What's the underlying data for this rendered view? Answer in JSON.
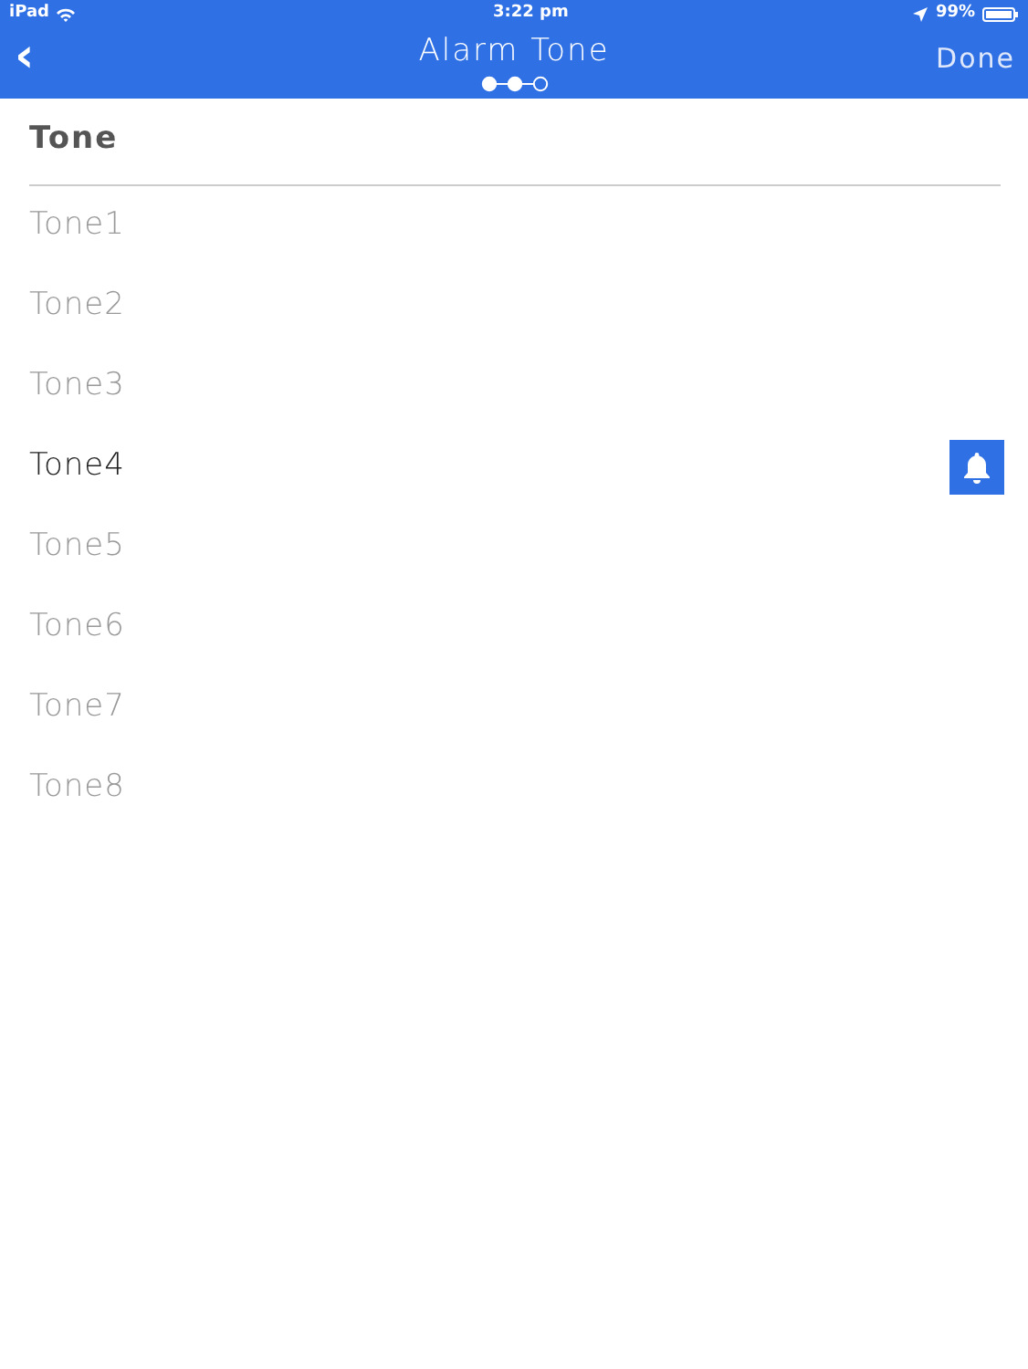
{
  "status_bar": {
    "device": "iPad",
    "time": "3:22 pm",
    "battery": "99%"
  },
  "nav": {
    "back": "‹",
    "title": "Alarm Tone",
    "done": "Done",
    "steps": [
      {
        "filled": true
      },
      {
        "filled": true
      },
      {
        "filled": false
      }
    ]
  },
  "section": {
    "header": "Tone"
  },
  "tones": [
    {
      "label": "Tone1",
      "selected": false
    },
    {
      "label": "Tone2",
      "selected": false
    },
    {
      "label": "Tone3",
      "selected": false
    },
    {
      "label": "Tone4",
      "selected": true
    },
    {
      "label": "Tone5",
      "selected": false
    },
    {
      "label": "Tone6",
      "selected": false
    },
    {
      "label": "Tone7",
      "selected": false
    },
    {
      "label": "Tone8",
      "selected": false
    }
  ]
}
